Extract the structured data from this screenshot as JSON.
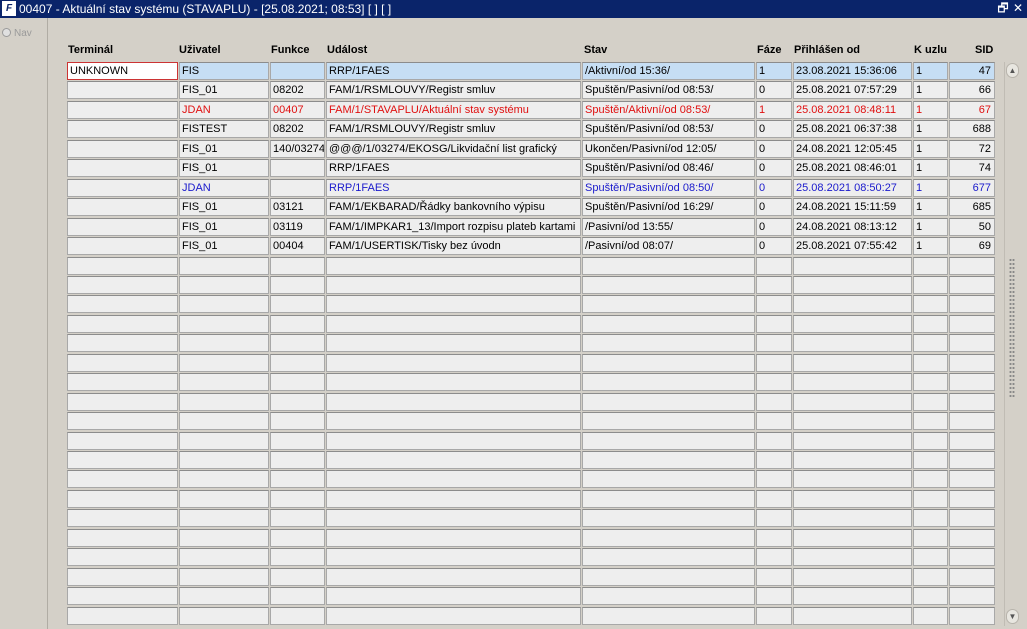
{
  "window": {
    "title": "00407 - Aktuální stav systému (STAVAPLU) - [25.08.2021; 08:53]  [ ]  [ ]",
    "icon": "app-logo-icon",
    "restore_glyph": "🗗",
    "close_glyph": "✕"
  },
  "nav": {
    "label": "Nav"
  },
  "columns": [
    "Terminál",
    "Uživatel",
    "Funkce",
    "Událost",
    "Stav",
    "Fáze",
    "Přihlášen od",
    "K uzlu",
    "SID"
  ],
  "rows": [
    {
      "terminal": "UNKNOWN",
      "user": "FIS",
      "func": "",
      "event": "RRP/1FAES",
      "state": "/Aktivní/od 15:36/",
      "phase": "1",
      "since": "23.08.2021 15:36:06",
      "node": "1",
      "sid": "47",
      "style": "selected"
    },
    {
      "terminal": "",
      "user": "FIS_01",
      "func": "08202",
      "event": "FAM/1/RSMLOUVY/Registr smluv",
      "state": "Spuštěn/Pasivní/od 08:53/",
      "phase": "0",
      "since": "25.08.2021 07:57:29",
      "node": "1",
      "sid": "66",
      "style": ""
    },
    {
      "terminal": "",
      "user": "JDAN",
      "func": "00407",
      "event": "FAM/1/STAVAPLU/Aktuální stav systému",
      "state": "Spuštěn/Aktivní/od 08:53/",
      "phase": "1",
      "since": "25.08.2021 08:48:11",
      "node": "1",
      "sid": "67",
      "style": "red"
    },
    {
      "terminal": "",
      "user": "FISTEST",
      "func": "08202",
      "event": "FAM/1/RSMLOUVY/Registr smluv",
      "state": "Spuštěn/Pasivní/od 08:53/",
      "phase": "0",
      "since": "25.08.2021 06:37:38",
      "node": "1",
      "sid": "688",
      "style": ""
    },
    {
      "terminal": "",
      "user": "FIS_01",
      "func": "140/03274",
      "event": "@@@/1/03274/EKOSG/Likvidační list grafický",
      "state": "Ukončen/Pasivní/od 12:05/",
      "phase": "0",
      "since": "24.08.2021 12:05:45",
      "node": "1",
      "sid": "72",
      "style": ""
    },
    {
      "terminal": "",
      "user": "FIS_01",
      "func": "",
      "event": "RRP/1FAES",
      "state": "Spuštěn/Pasivní/od 08:46/",
      "phase": "0",
      "since": "25.08.2021 08:46:01",
      "node": "1",
      "sid": "74",
      "style": ""
    },
    {
      "terminal": "",
      "user": "JDAN",
      "func": "",
      "event": "RRP/1FAES",
      "state": "Spuštěn/Pasivní/od 08:50/",
      "phase": "0",
      "since": "25.08.2021 08:50:27",
      "node": "1",
      "sid": "677",
      "style": "blue"
    },
    {
      "terminal": "",
      "user": "FIS_01",
      "func": "03121",
      "event": "FAM/1/EKBARAD/Řádky bankovního výpisu",
      "state": "Spuštěn/Pasivní/od 16:29/",
      "phase": "0",
      "since": "24.08.2021 15:11:59",
      "node": "1",
      "sid": "685",
      "style": ""
    },
    {
      "terminal": "",
      "user": "FIS_01",
      "func": "03119",
      "event": "FAM/1/IMPKAR1_13/Import rozpisu plateb kartami",
      "state": "/Pasivní/od 13:55/",
      "phase": "0",
      "since": "24.08.2021 08:13:12",
      "node": "1",
      "sid": "50",
      "style": ""
    },
    {
      "terminal": "",
      "user": "FIS_01",
      "func": "00404",
      "event": "FAM/1/USERTISK/Tisky bez úvodn",
      "state": "/Pasivní/od 08:07/",
      "phase": "0",
      "since": "25.08.2021 07:55:42",
      "node": "1",
      "sid": "69",
      "style": ""
    }
  ],
  "empty_rows": 19,
  "colors": {
    "titlebar": "#0a246a",
    "selected_row": "#c6def4",
    "red_text": "#e01010",
    "blue_text": "#1a1acc"
  },
  "scrollbar": {
    "up_icon": "scroll-up-arrow-icon",
    "down_icon": "scroll-down-arrow-icon",
    "up_glyph": "▲",
    "down_glyph": "▼"
  }
}
